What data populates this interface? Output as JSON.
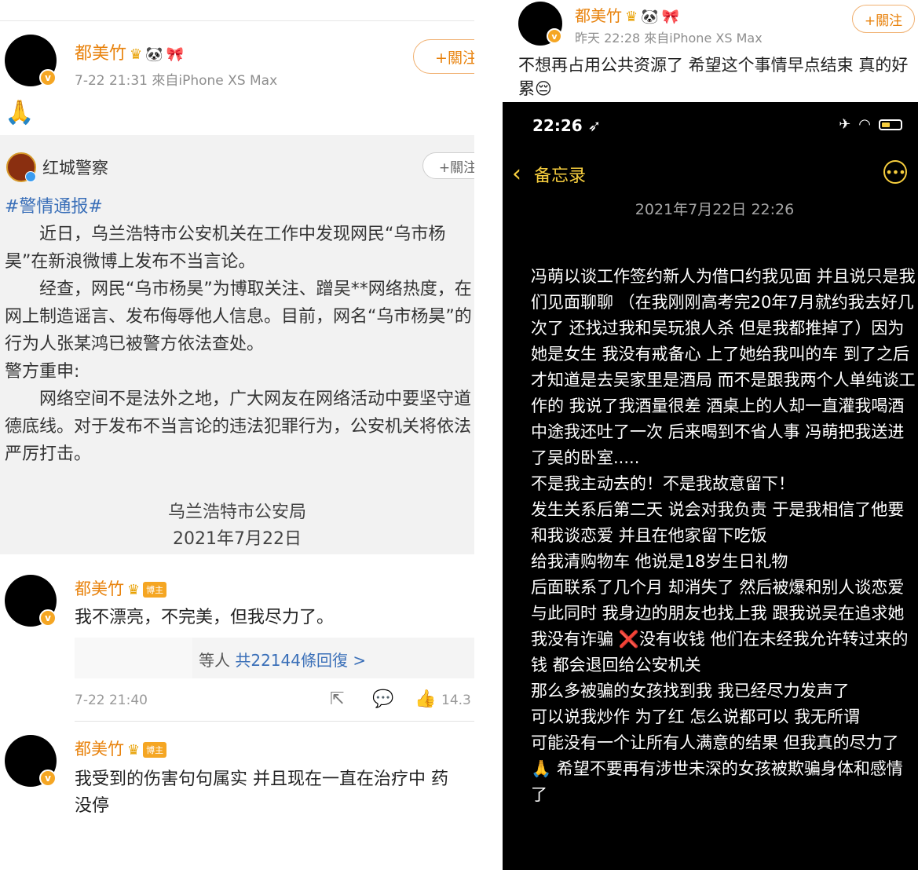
{
  "left": {
    "post": {
      "user": "都美竹",
      "badges": {
        "crown": "♛",
        "panda": "🐼",
        "bow": "🎀"
      },
      "time_source": "7-22 21:31  來自iPhone XS Max",
      "follow": "+關注",
      "content": "🙏"
    },
    "repost": {
      "user": "红城警察",
      "follow": "+關注",
      "tag": "#警情通报#",
      "paragraphs": [
        "　　近日，乌兰浩特市公安机关在工作中发现网民“乌市杨昊”在新浪微博上发布不当言论。",
        "　　经查，网民“乌市杨昊”为博取关注、蹭吴**网络热度，在网上制造谣言、发布侮辱他人信息。目前，网名“乌市杨昊”的行为人张某鸿已被警方依法查处。",
        "警方重申:",
        "　　网络空间不是法外之地，广大网友在网络活动中要坚守道德底线。对于发布不当言论的违法犯罪行为，公安机关将依法严厉打击。"
      ],
      "signature": "乌兰浩特市公安局",
      "date": "2021年7月22日"
    },
    "comment1": {
      "user": "都美竹",
      "badge": "博主",
      "text": "我不漂亮，不完美，但我尽力了。",
      "reply_partial": "等人",
      "reply_link": "共22144條回復 >",
      "time": "7-22 21:40",
      "likes": "14.3"
    },
    "comment2": {
      "user": "都美竹",
      "badge": "博主",
      "lines": [
        "我受到的伤害句句属实 并且现在一直在治疗中 药",
        "没停"
      ]
    }
  },
  "right": {
    "post": {
      "user": "都美竹",
      "badges": {
        "crown": "♛",
        "panda": "🐼",
        "bow": "🎀"
      },
      "time_source": "昨天 22:28  來自iPhone XS Max",
      "follow": "+關注",
      "text": "不想再占用公共资源了 希望这个事情早点结束 真的好累😔"
    },
    "phone": {
      "time": "22:26",
      "back_label": "备忘录",
      "date": "2021年7月22日 22:26",
      "lines": [
        "冯萌以谈工作签约新人为借口约我见面 并且说只是我们见面聊聊 （在我刚刚高考完20年7月就约我去好几次了 还找过我和吴玩狼人杀 但是我都推掉了）因为她是女生 我没有戒备心 上了她给我叫的车 到了之后才知道是去吴家里是酒局 而不是跟我两个人单纯谈工作的 我说了我酒量很差 酒桌上的人却一直灌我喝酒 中途我还吐了一次 后来喝到不省人事 冯萌把我送进了吴的卧室.....",
        "不是我主动去的！不是我故意留下！",
        "发生关系后第二天 说会对我负责 于是我相信了他要和我谈恋爱 并且在他家留下吃饭",
        "给我清购物车 他说是18岁生日礼物",
        "后面联系了几个月 却消失了 然后被爆和别人谈恋爱 与此同时 我身边的朋友也找上我 跟我说吴在追求她",
        "我没有诈骗 ❌没有收钱 他们在未经我允许转过来的钱 都会退回给公安机关",
        "那么多被骗的女孩找到我 我已经尽力发声了",
        "可以说我炒作 为了红 怎么说都可以 我无所谓",
        "可能没有一个让所有人满意的结果 但我真的尽力了🙏 希望不要再有涉世未深的女孩被欺骗身体和感情了"
      ]
    }
  },
  "colors": {
    "weibo_orange": "#e8820c",
    "notes_yellow": "#f7ce3e",
    "link_blue": "#3a6fb8"
  }
}
